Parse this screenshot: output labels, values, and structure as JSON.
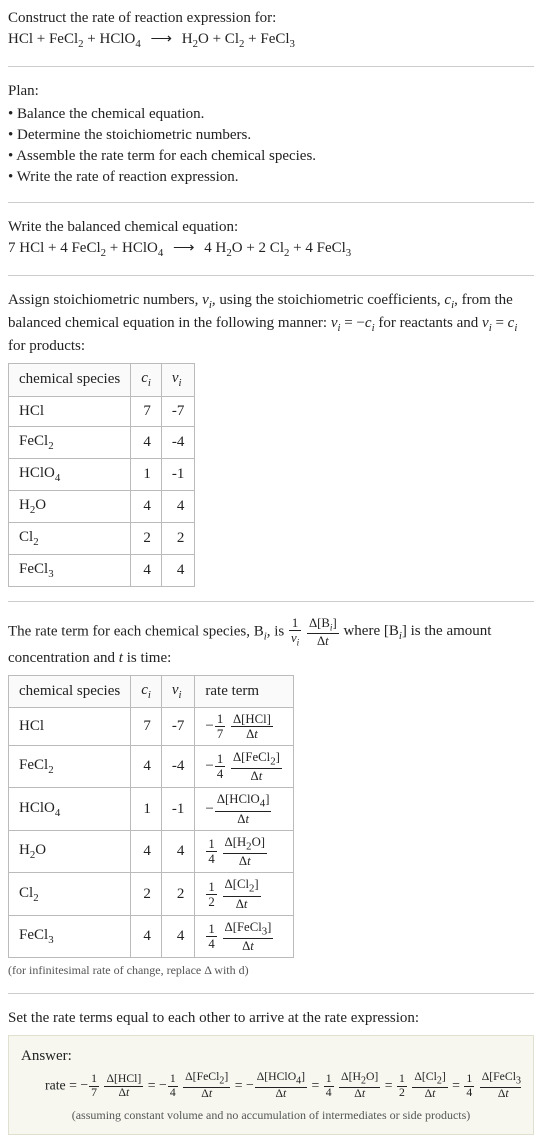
{
  "title": "Construct the rate of reaction expression for:",
  "unbalanced_equation_html": "HCl + FeCl<span class='sub'>2</span> + HClO<span class='sub'>4</span> <span class='arrow'>⟶</span> H<span class='sub'>2</span>O + Cl<span class='sub'>2</span> + FeCl<span class='sub'>3</span>",
  "plan_label": "Plan:",
  "plan_items": [
    "Balance the chemical equation.",
    "Determine the stoichiometric numbers.",
    "Assemble the rate term for each chemical species.",
    "Write the rate of reaction expression."
  ],
  "balanced_label": "Write the balanced chemical equation:",
  "balanced_equation_html": "7 HCl + 4 FeCl<span class='sub'>2</span> + HClO<span class='sub'>4</span> <span class='arrow'>⟶</span> 4 H<span class='sub'>2</span>O + 2 Cl<span class='sub'>2</span> + 4 FeCl<span class='sub'>3</span>",
  "assign_html": "Assign stoichiometric numbers, <i>ν<span class='sub'>i</span></i>, using the stoichiometric coefficients, <i>c<span class='sub'>i</span></i>, from the balanced chemical equation in the following manner: <i>ν<span class='sub'>i</span></i> = −<i>c<span class='sub'>i</span></i> for reactants and <i>ν<span class='sub'>i</span></i> = <i>c<span class='sub'>i</span></i> for products:",
  "table1_headers": {
    "species": "chemical species",
    "ci": "c_i",
    "vi": "ν_i"
  },
  "table1_rows": [
    {
      "species_html": "HCl",
      "ci": "7",
      "vi": "-7"
    },
    {
      "species_html": "FeCl<span class='sub'>2</span>",
      "ci": "4",
      "vi": "-4"
    },
    {
      "species_html": "HClO<span class='sub'>4</span>",
      "ci": "1",
      "vi": "-1"
    },
    {
      "species_html": "H<span class='sub'>2</span>O",
      "ci": "4",
      "vi": "4"
    },
    {
      "species_html": "Cl<span class='sub'>2</span>",
      "ci": "2",
      "vi": "2"
    },
    {
      "species_html": "FeCl<span class='sub'>3</span>",
      "ci": "4",
      "vi": "4"
    }
  ],
  "rate_intro_pre": "The rate term for each chemical species, B",
  "rate_intro_mid": ", is ",
  "rate_intro_post_html": " where [B<span class='sub'><i>i</i></span>] is the amount concentration and <i>t</i> is time:",
  "table2_headers": {
    "species": "chemical species",
    "ci": "c_i",
    "vi": "ν_i",
    "rate": "rate term"
  },
  "table2_rows": [
    {
      "species_html": "HCl",
      "ci": "7",
      "vi": "-7",
      "coef_num": "1",
      "coef_den": "7",
      "delta_html": "Δ[HCl]",
      "neg": true
    },
    {
      "species_html": "FeCl<span class='sub'>2</span>",
      "ci": "4",
      "vi": "-4",
      "coef_num": "1",
      "coef_den": "4",
      "delta_html": "Δ[FeCl<span class='sub' style='font-size:0.85em'>2</span>]",
      "neg": true
    },
    {
      "species_html": "HClO<span class='sub'>4</span>",
      "ci": "1",
      "vi": "-1",
      "coef_num": "",
      "coef_den": "",
      "delta_html": "Δ[HClO<span class='sub' style='font-size:0.85em'>4</span>]",
      "neg": true
    },
    {
      "species_html": "H<span class='sub'>2</span>O",
      "ci": "4",
      "vi": "4",
      "coef_num": "1",
      "coef_den": "4",
      "delta_html": "Δ[H<span class='sub' style='font-size:0.85em'>2</span>O]",
      "neg": false
    },
    {
      "species_html": "Cl<span class='sub'>2</span>",
      "ci": "2",
      "vi": "2",
      "coef_num": "1",
      "coef_den": "2",
      "delta_html": "Δ[Cl<span class='sub' style='font-size:0.85em'>2</span>]",
      "neg": false
    },
    {
      "species_html": "FeCl<span class='sub'>3</span>",
      "ci": "4",
      "vi": "4",
      "coef_num": "1",
      "coef_den": "4",
      "delta_html": "Δ[FeCl<span class='sub' style='font-size:0.85em'>3</span>]",
      "neg": false
    }
  ],
  "footnote1": "(for infinitesimal rate of change, replace Δ with d)",
  "set_equal": "Set the rate terms equal to each other to arrive at the rate expression:",
  "answer_label": "Answer:",
  "answer_prefix": "rate = ",
  "answer_terms": [
    {
      "neg": true,
      "coef_num": "1",
      "coef_den": "7",
      "delta_html": "Δ[HCl]"
    },
    {
      "neg": true,
      "coef_num": "1",
      "coef_den": "4",
      "delta_html": "Δ[FeCl<span class='sub' style='font-size:0.85em'>2</span>]"
    },
    {
      "neg": true,
      "coef_num": "",
      "coef_den": "",
      "delta_html": "Δ[HClO<span class='sub' style='font-size:0.85em'>4</span>]"
    },
    {
      "neg": false,
      "coef_num": "1",
      "coef_den": "4",
      "delta_html": "Δ[H<span class='sub' style='font-size:0.85em'>2</span>O]"
    },
    {
      "neg": false,
      "coef_num": "1",
      "coef_den": "2",
      "delta_html": "Δ[Cl<span class='sub' style='font-size:0.85em'>2</span>]"
    },
    {
      "neg": false,
      "coef_num": "1",
      "coef_den": "4",
      "delta_html": "Δ[FeCl<span class='sub' style='font-size:0.85em'>3</span>]"
    }
  ],
  "footnote2": "(assuming constant volume and no accumulation of intermediates or side products)"
}
